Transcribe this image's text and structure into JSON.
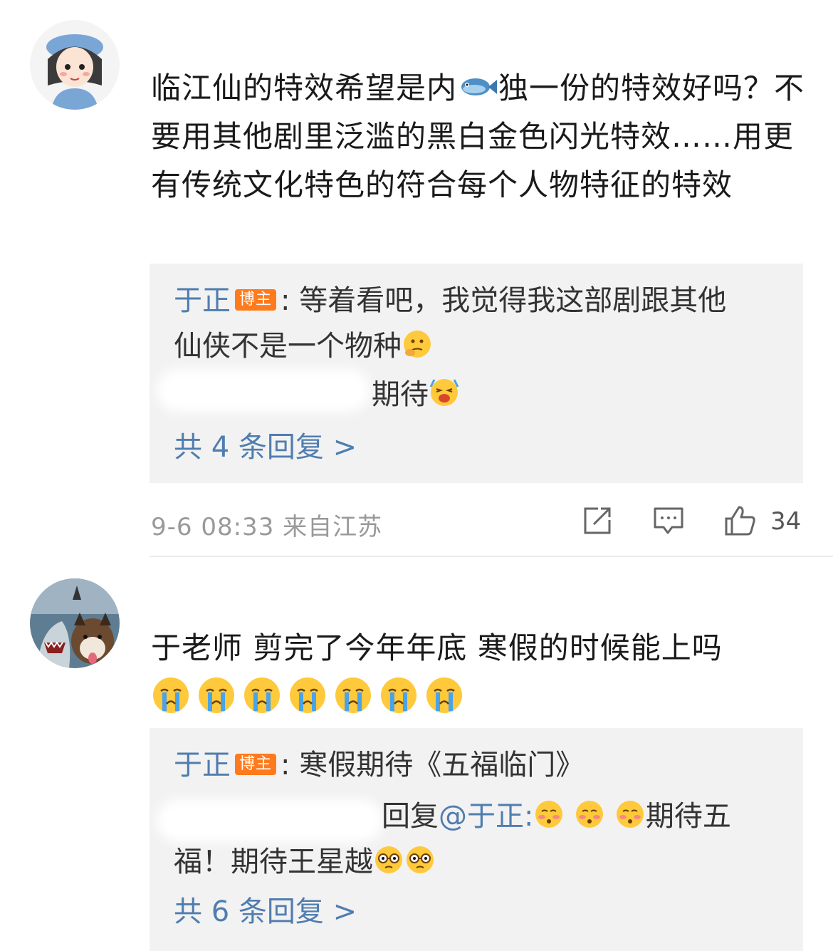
{
  "comments": [
    {
      "avatar_icon": "girl-avatar-icon",
      "text_part1": "临江仙的特效希望是内",
      "text_inline_icon": "fish-emoji-icon",
      "text_part2": "独一份的特效好吗？不要用其他剧里泛滥的黑白金色闪光特效……用更有传统文化特色的符合每个人物特征的特效",
      "replies": [
        {
          "author": "于正",
          "badge": "博主",
          "separator": ":",
          "text_a": "等着看吧，我觉得我这部剧跟其他",
          "text_b": "仙侠不是一个物种",
          "emoji": "thinking-emoji-icon"
        },
        {
          "text": "期待",
          "emoji": "excited-emoji-icon"
        }
      ],
      "more_replies": "共 4 条回复 >",
      "time": "9-6 08:33",
      "location": "来自江苏",
      "like_count": "34"
    },
    {
      "avatar_icon": "shark-and-dog-avatar-icon",
      "text": "于老师  剪完了今年年底 寒假的时候能上吗",
      "crying_emoji_count": 7,
      "replies": [
        {
          "author": "于正",
          "badge": "博主",
          "separator": ":",
          "text": "寒假期待《五福临门》"
        },
        {
          "prefix": "回复",
          "mention": "@于正:",
          "text_a": "期待五",
          "text_b": "福！期待王星越"
        }
      ],
      "more_replies": "共 6 条回复 >"
    }
  ],
  "colors": {
    "author_link": "#507daf",
    "badge": "#ff7a1c",
    "reply_bg": "#f2f2f2",
    "meta_text": "#999999"
  }
}
